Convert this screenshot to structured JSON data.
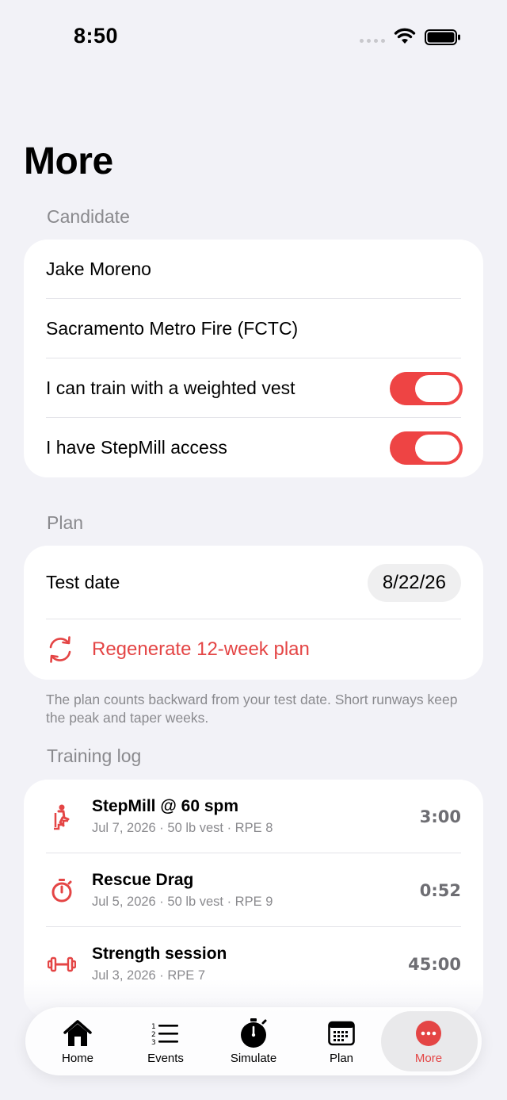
{
  "status_bar": {
    "time": "8:50"
  },
  "page": {
    "title": "More"
  },
  "candidate": {
    "header": "Candidate",
    "name": "Jake Moreno",
    "department": "Sacramento Metro Fire (FCTC)",
    "weighted_vest": {
      "label": "I can train with a weighted vest",
      "on": true
    },
    "stepmill": {
      "label": "I have StepMill access",
      "on": true
    }
  },
  "plan": {
    "header": "Plan",
    "test_date_label": "Test date",
    "test_date_value": "8/22/26",
    "regenerate_label": "Regenerate 12-week plan",
    "footnote": "The plan counts backward from your test date. Short runways keep the peak and taper weeks."
  },
  "training_log": {
    "header": "Training log",
    "entries": [
      {
        "icon": "stepmill-icon",
        "title": "StepMill @ 60 spm",
        "subtitle": "Jul 7, 2026 · 50 lb vest · RPE 8",
        "duration": "3:00"
      },
      {
        "icon": "stopwatch-icon",
        "title": "Rescue Drag",
        "subtitle": "Jul 5, 2026 · 50 lb vest · RPE 9",
        "duration": "0:52"
      },
      {
        "icon": "dumbbell-icon",
        "title": "Strength session",
        "subtitle": "Jul 3, 2026 · RPE 7",
        "duration": "45:00"
      }
    ]
  },
  "tab_bar": {
    "accent": "#E44545",
    "tabs": [
      {
        "label": "Home",
        "icon": "home-icon"
      },
      {
        "label": "Events",
        "icon": "list-icon"
      },
      {
        "label": "Simulate",
        "icon": "timer-icon"
      },
      {
        "label": "Plan",
        "icon": "calendar-icon"
      },
      {
        "label": "More",
        "icon": "more-icon",
        "active": true
      }
    ]
  }
}
